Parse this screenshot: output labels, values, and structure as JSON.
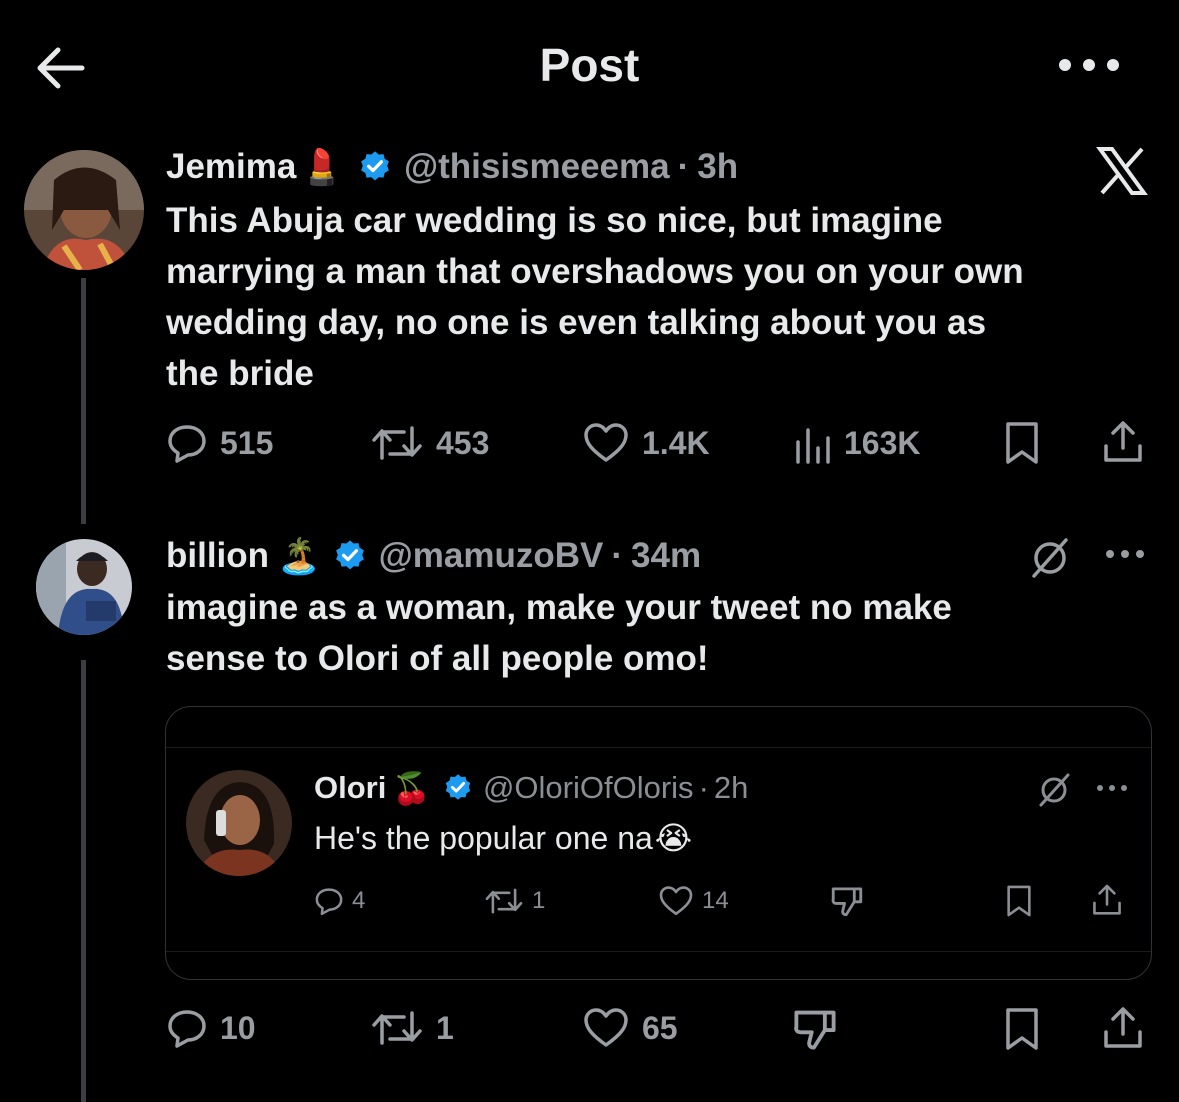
{
  "header": {
    "title": "Post"
  },
  "tweet1": {
    "name": "Jemima",
    "name_emoji": "💄",
    "handle": "@thisismeeema",
    "time": "3h",
    "text_lines": [
      "This Abuja car wedding is so nice, but imagine",
      "marrying a man that overshadows you on your own",
      "wedding day, no one is even talking about you as",
      "the bride"
    ],
    "replies": "515",
    "reposts": "453",
    "likes": "1.4K",
    "views": "163K"
  },
  "tweet2": {
    "name": "billion",
    "name_emoji": "🏝️",
    "handle": "@mamuzoBV",
    "time": "34m",
    "text_lines": [
      "imagine as a woman, make your tweet no make",
      "sense to Olori of all people omo!"
    ],
    "replies": "10",
    "reposts": "1",
    "likes": "65"
  },
  "quote": {
    "name": "Olori",
    "name_emoji": "🍒",
    "handle": "@OloriOfOloris",
    "time": "2h",
    "text": "He's the popular one na",
    "text_emoji": "😭",
    "replies": "4",
    "reposts": "1",
    "likes": "14"
  },
  "colors": {
    "verified": "#1d9bf0",
    "background": "#000000",
    "muted": "#9a9ea3"
  }
}
